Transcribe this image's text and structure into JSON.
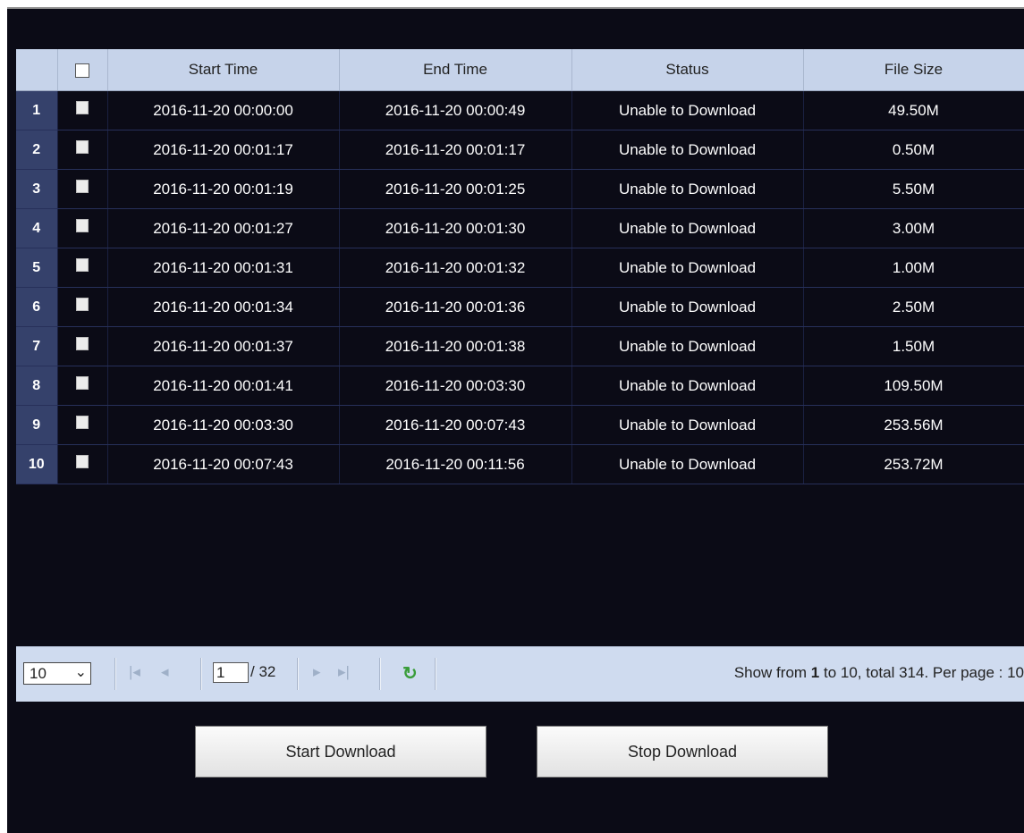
{
  "table": {
    "columns": [
      "",
      "",
      "Start Time",
      "End Time",
      "Status",
      "File Size"
    ],
    "rows": [
      {
        "no": "1",
        "start": "2016-11-20 00:00:00",
        "end": "2016-11-20 00:00:49",
        "status": "Unable to Download",
        "size": "49.50M"
      },
      {
        "no": "2",
        "start": "2016-11-20 00:01:17",
        "end": "2016-11-20 00:01:17",
        "status": "Unable to Download",
        "size": "0.50M"
      },
      {
        "no": "3",
        "start": "2016-11-20 00:01:19",
        "end": "2016-11-20 00:01:25",
        "status": "Unable to Download",
        "size": "5.50M"
      },
      {
        "no": "4",
        "start": "2016-11-20 00:01:27",
        "end": "2016-11-20 00:01:30",
        "status": "Unable to Download",
        "size": "3.00M"
      },
      {
        "no": "5",
        "start": "2016-11-20 00:01:31",
        "end": "2016-11-20 00:01:32",
        "status": "Unable to Download",
        "size": "1.00M"
      },
      {
        "no": "6",
        "start": "2016-11-20 00:01:34",
        "end": "2016-11-20 00:01:36",
        "status": "Unable to Download",
        "size": "2.50M"
      },
      {
        "no": "7",
        "start": "2016-11-20 00:01:37",
        "end": "2016-11-20 00:01:38",
        "status": "Unable to Download",
        "size": "1.50M"
      },
      {
        "no": "8",
        "start": "2016-11-20 00:01:41",
        "end": "2016-11-20 00:03:30",
        "status": "Unable to Download",
        "size": "109.50M"
      },
      {
        "no": "9",
        "start": "2016-11-20 00:03:30",
        "end": "2016-11-20 00:07:43",
        "status": "Unable to Download",
        "size": "253.56M"
      },
      {
        "no": "10",
        "start": "2016-11-20 00:07:43",
        "end": "2016-11-20 00:11:56",
        "status": "Unable to Download",
        "size": "253.72M"
      }
    ]
  },
  "pager": {
    "per_page_select": "10",
    "current_page": "1",
    "total_pages": "/ 32",
    "info_prefix": "Show from ",
    "info_from": "1",
    "info_suffix": " to 10, total 314. Per page : 10"
  },
  "buttons": {
    "start_download": "Start Download",
    "stop_download": "Stop Download"
  },
  "colors": {
    "background": "#0b0b16",
    "header": "#c6d3ea",
    "row_number_cell": "#35416b",
    "toolbar": "#cfdbef"
  }
}
